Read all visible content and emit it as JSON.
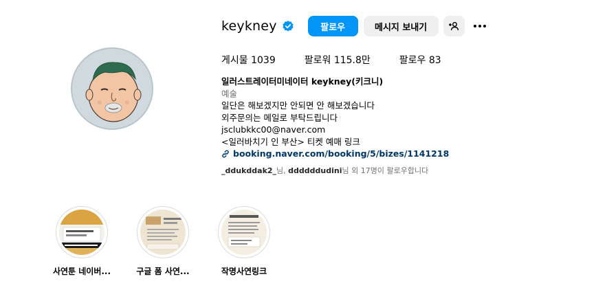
{
  "profile": {
    "username": "keykney",
    "follow_label": "팔로우",
    "message_label": "메시지 보내기"
  },
  "stats": {
    "posts_label": "게시물",
    "posts_value": "1039",
    "followers_label": "팔로워",
    "followers_value": "115.8만",
    "following_label": "팔로우",
    "following_value": "83"
  },
  "bio": {
    "name": "일러스트레이터미네이터 keykney(키크니)",
    "category": "예술",
    "line1": "일단은 해보겠지만 안되면 안 해보겠습니다",
    "line2": "외주문의는 메일로 부탁드립니다",
    "email": "jsclubkkc00@naver.com",
    "line3": "<일러바치기 인 부산> 티켓 예매 링크",
    "link": "booking.naver.com/booking/5/bizes/1141218"
  },
  "followed_by": {
    "user1": "_ddukddak2_",
    "sep1": "님, ",
    "user2": "ddddddudini",
    "rest": "님 외 17명이 팔로우합니다"
  },
  "highlights": [
    {
      "label": "사연툰 네이버...",
      "icon": "highlight-cover-1"
    },
    {
      "label": "구글 폼 사연...",
      "icon": "highlight-cover-2"
    },
    {
      "label": "작명사연링크",
      "icon": "highlight-cover-3"
    }
  ],
  "colors": {
    "primary": "#0095f6",
    "secondary_button": "#efefef",
    "link": "#00376b",
    "muted": "#737373"
  }
}
